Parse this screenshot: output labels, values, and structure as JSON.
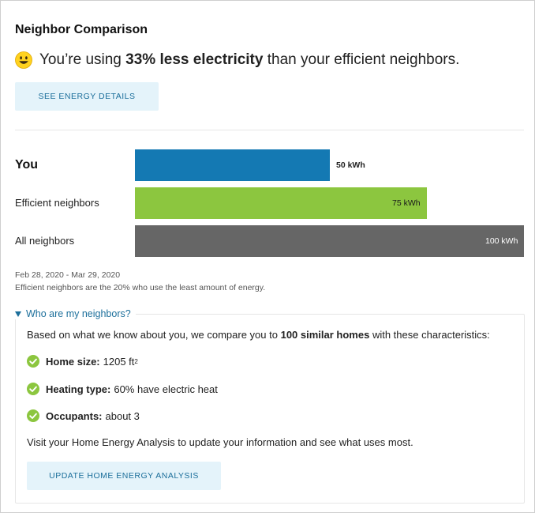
{
  "card": {
    "title": "Neighbor Comparison",
    "headline": {
      "pre": "You’re using ",
      "bold": "33% less electricity",
      "post": " than your efficient neighbors."
    },
    "details_button": "SEE ENERGY DETAILS"
  },
  "comparison": {
    "rows": [
      {
        "label": "You",
        "value": 50,
        "value_label": "50 kWh",
        "color": "#1479b3"
      },
      {
        "label": "Efficient neighbors",
        "value": 75,
        "value_label": "75 kWh",
        "color": "#8cc63f"
      },
      {
        "label": "All neighbors",
        "value": 100,
        "value_label": "100 kWh",
        "color": "#666666"
      }
    ],
    "date_range": "Feb 28, 2020 - Mar 29, 2020",
    "footnote": "Efficient neighbors are the 20% who use the least amount of energy."
  },
  "neighbors": {
    "toggle_label": "Who are my neighbors?",
    "intro": {
      "pre": "Based on what we know about you, we compare you to ",
      "bold": "100 similar homes",
      "post": " with these characteristics:"
    },
    "characteristics": [
      {
        "label": "Home size:",
        "value": "1205 ft",
        "sup": "2"
      },
      {
        "label": "Heating type:",
        "value": "60% have electric heat",
        "sup": ""
      },
      {
        "label": "Occupants:",
        "value": "about 3",
        "sup": ""
      }
    ],
    "visit_text": "Visit your Home Energy Analysis to update your information and see what uses most.",
    "update_button": "UPDATE HOME ENERGY ANALYSIS"
  },
  "colors": {
    "accent": "#1c6f9b",
    "check": "#8cc63f",
    "button_bg": "#e4f3fa"
  },
  "icons": {
    "smiley": "smiley-face-icon",
    "check": "check-circle-icon",
    "disclosure": "triangle-down-icon"
  }
}
